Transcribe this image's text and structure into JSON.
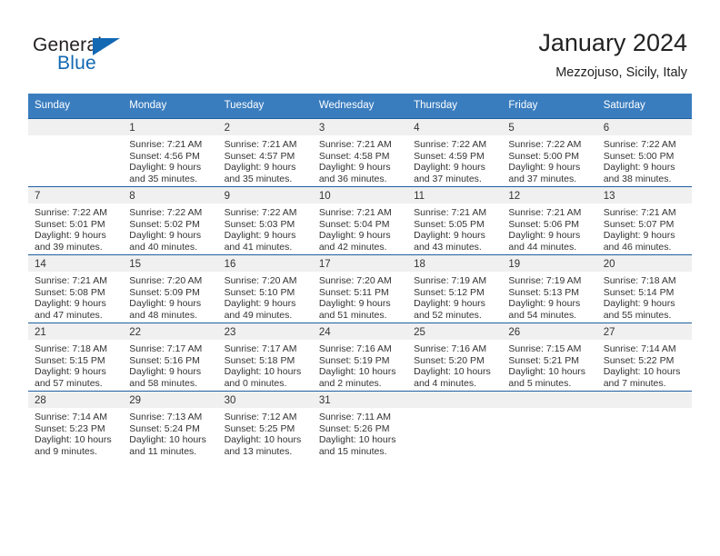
{
  "brand": {
    "name_part1": "General",
    "name_part2": "Blue",
    "triangle_color": "#1268b3",
    "logo_icon": "triangle-flag-icon"
  },
  "header": {
    "title": "January 2024",
    "subtitle": "Mezzojuso, Sicily, Italy",
    "header_bg": "#3a7dbf",
    "daynum_band_bg": "#f0f0f0",
    "cell_border_color": "#1f5fa0"
  },
  "weekday_headers": [
    "Sunday",
    "Monday",
    "Tuesday",
    "Wednesday",
    "Thursday",
    "Friday",
    "Saturday"
  ],
  "weeks": [
    [
      {
        "day": "",
        "lines": []
      },
      {
        "day": "1",
        "lines": [
          "Sunrise: 7:21 AM",
          "Sunset: 4:56 PM",
          "Daylight: 9 hours",
          "and 35 minutes."
        ]
      },
      {
        "day": "2",
        "lines": [
          "Sunrise: 7:21 AM",
          "Sunset: 4:57 PM",
          "Daylight: 9 hours",
          "and 35 minutes."
        ]
      },
      {
        "day": "3",
        "lines": [
          "Sunrise: 7:21 AM",
          "Sunset: 4:58 PM",
          "Daylight: 9 hours",
          "and 36 minutes."
        ]
      },
      {
        "day": "4",
        "lines": [
          "Sunrise: 7:22 AM",
          "Sunset: 4:59 PM",
          "Daylight: 9 hours",
          "and 37 minutes."
        ]
      },
      {
        "day": "5",
        "lines": [
          "Sunrise: 7:22 AM",
          "Sunset: 5:00 PM",
          "Daylight: 9 hours",
          "and 37 minutes."
        ]
      },
      {
        "day": "6",
        "lines": [
          "Sunrise: 7:22 AM",
          "Sunset: 5:00 PM",
          "Daylight: 9 hours",
          "and 38 minutes."
        ]
      }
    ],
    [
      {
        "day": "7",
        "lines": [
          "Sunrise: 7:22 AM",
          "Sunset: 5:01 PM",
          "Daylight: 9 hours",
          "and 39 minutes."
        ]
      },
      {
        "day": "8",
        "lines": [
          "Sunrise: 7:22 AM",
          "Sunset: 5:02 PM",
          "Daylight: 9 hours",
          "and 40 minutes."
        ]
      },
      {
        "day": "9",
        "lines": [
          "Sunrise: 7:22 AM",
          "Sunset: 5:03 PM",
          "Daylight: 9 hours",
          "and 41 minutes."
        ]
      },
      {
        "day": "10",
        "lines": [
          "Sunrise: 7:21 AM",
          "Sunset: 5:04 PM",
          "Daylight: 9 hours",
          "and 42 minutes."
        ]
      },
      {
        "day": "11",
        "lines": [
          "Sunrise: 7:21 AM",
          "Sunset: 5:05 PM",
          "Daylight: 9 hours",
          "and 43 minutes."
        ]
      },
      {
        "day": "12",
        "lines": [
          "Sunrise: 7:21 AM",
          "Sunset: 5:06 PM",
          "Daylight: 9 hours",
          "and 44 minutes."
        ]
      },
      {
        "day": "13",
        "lines": [
          "Sunrise: 7:21 AM",
          "Sunset: 5:07 PM",
          "Daylight: 9 hours",
          "and 46 minutes."
        ]
      }
    ],
    [
      {
        "day": "14",
        "lines": [
          "Sunrise: 7:21 AM",
          "Sunset: 5:08 PM",
          "Daylight: 9 hours",
          "and 47 minutes."
        ]
      },
      {
        "day": "15",
        "lines": [
          "Sunrise: 7:20 AM",
          "Sunset: 5:09 PM",
          "Daylight: 9 hours",
          "and 48 minutes."
        ]
      },
      {
        "day": "16",
        "lines": [
          "Sunrise: 7:20 AM",
          "Sunset: 5:10 PM",
          "Daylight: 9 hours",
          "and 49 minutes."
        ]
      },
      {
        "day": "17",
        "lines": [
          "Sunrise: 7:20 AM",
          "Sunset: 5:11 PM",
          "Daylight: 9 hours",
          "and 51 minutes."
        ]
      },
      {
        "day": "18",
        "lines": [
          "Sunrise: 7:19 AM",
          "Sunset: 5:12 PM",
          "Daylight: 9 hours",
          "and 52 minutes."
        ]
      },
      {
        "day": "19",
        "lines": [
          "Sunrise: 7:19 AM",
          "Sunset: 5:13 PM",
          "Daylight: 9 hours",
          "and 54 minutes."
        ]
      },
      {
        "day": "20",
        "lines": [
          "Sunrise: 7:18 AM",
          "Sunset: 5:14 PM",
          "Daylight: 9 hours",
          "and 55 minutes."
        ]
      }
    ],
    [
      {
        "day": "21",
        "lines": [
          "Sunrise: 7:18 AM",
          "Sunset: 5:15 PM",
          "Daylight: 9 hours",
          "and 57 minutes."
        ]
      },
      {
        "day": "22",
        "lines": [
          "Sunrise: 7:17 AM",
          "Sunset: 5:16 PM",
          "Daylight: 9 hours",
          "and 58 minutes."
        ]
      },
      {
        "day": "23",
        "lines": [
          "Sunrise: 7:17 AM",
          "Sunset: 5:18 PM",
          "Daylight: 10 hours",
          "and 0 minutes."
        ]
      },
      {
        "day": "24",
        "lines": [
          "Sunrise: 7:16 AM",
          "Sunset: 5:19 PM",
          "Daylight: 10 hours",
          "and 2 minutes."
        ]
      },
      {
        "day": "25",
        "lines": [
          "Sunrise: 7:16 AM",
          "Sunset: 5:20 PM",
          "Daylight: 10 hours",
          "and 4 minutes."
        ]
      },
      {
        "day": "26",
        "lines": [
          "Sunrise: 7:15 AM",
          "Sunset: 5:21 PM",
          "Daylight: 10 hours",
          "and 5 minutes."
        ]
      },
      {
        "day": "27",
        "lines": [
          "Sunrise: 7:14 AM",
          "Sunset: 5:22 PM",
          "Daylight: 10 hours",
          "and 7 minutes."
        ]
      }
    ],
    [
      {
        "day": "28",
        "lines": [
          "Sunrise: 7:14 AM",
          "Sunset: 5:23 PM",
          "Daylight: 10 hours",
          "and 9 minutes."
        ]
      },
      {
        "day": "29",
        "lines": [
          "Sunrise: 7:13 AM",
          "Sunset: 5:24 PM",
          "Daylight: 10 hours",
          "and 11 minutes."
        ]
      },
      {
        "day": "30",
        "lines": [
          "Sunrise: 7:12 AM",
          "Sunset: 5:25 PM",
          "Daylight: 10 hours",
          "and 13 minutes."
        ]
      },
      {
        "day": "31",
        "lines": [
          "Sunrise: 7:11 AM",
          "Sunset: 5:26 PM",
          "Daylight: 10 hours",
          "and 15 minutes."
        ]
      },
      {
        "day": "",
        "lines": []
      },
      {
        "day": "",
        "lines": []
      },
      {
        "day": "",
        "lines": []
      }
    ]
  ]
}
